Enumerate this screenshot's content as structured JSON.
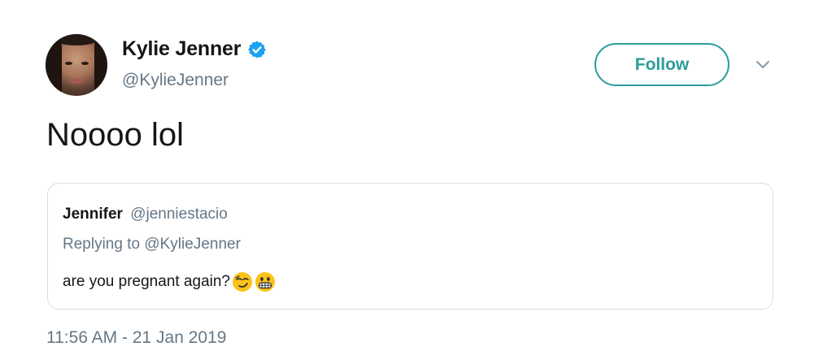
{
  "author": {
    "display_name": "Kylie Jenner",
    "handle": "@KylieJenner",
    "verified": true
  },
  "actions": {
    "follow_label": "Follow",
    "menu_icon": "chevron-down-icon"
  },
  "tweet": {
    "text": "Noooo lol",
    "timestamp": "11:56 AM - 21 Jan 2019"
  },
  "quoted_tweet": {
    "author_name": "Jennifer",
    "author_handle": "@jenniestacio",
    "replying_to_prefix": "Replying to",
    "replying_to_handle": "@KylieJenner",
    "text": "are you pregnant again?",
    "emojis": [
      "smirking-face-emoji",
      "grimacing-face-emoji"
    ]
  },
  "colors": {
    "follow_accent": "#2a9d96",
    "secondary_text": "#657786",
    "verified_blue": "#1da1f2",
    "primary_text": "#14171a"
  }
}
